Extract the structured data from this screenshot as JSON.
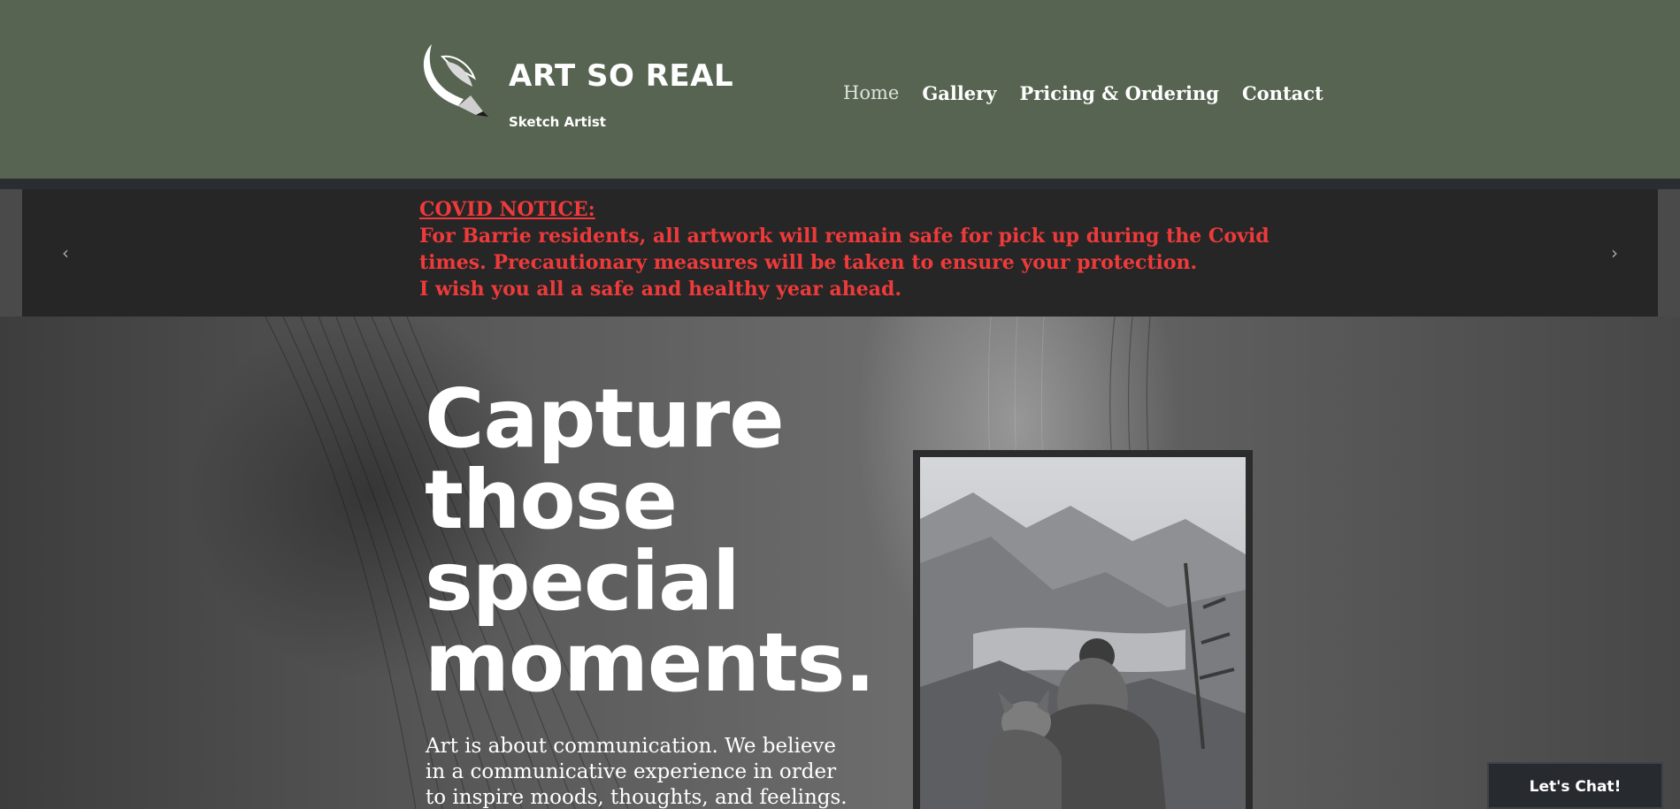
{
  "header": {
    "brand_title": "ART SO REAL",
    "brand_subtitle": "Sketch Artist",
    "logo_icon": "quill-pencil-icon",
    "background_color": "#576451"
  },
  "nav": {
    "items": [
      {
        "label": "Home",
        "active": true
      },
      {
        "label": "Gallery",
        "active": false
      },
      {
        "label": "Pricing & Ordering",
        "active": false
      },
      {
        "label": "Contact",
        "active": false
      }
    ]
  },
  "banner": {
    "title": "COVID NOTICE:",
    "line1": "For Barrie residents, all artwork will remain safe for pick up during the Covid times. Precautionary measures will be taken to ensure your protection.",
    "line2": "I wish you all a safe and healthy year ahead.",
    "prev_icon": "chevron-left-icon",
    "next_icon": "chevron-right-icon",
    "text_color": "#ee3a3a"
  },
  "hero": {
    "headline": [
      "Capture",
      "those",
      "special",
      "moments."
    ],
    "body": "Art is about communication. We believe in a communicative experience in order to inspire moods, thoughts, and feelings."
  },
  "chat": {
    "label": "Let's Chat!"
  }
}
